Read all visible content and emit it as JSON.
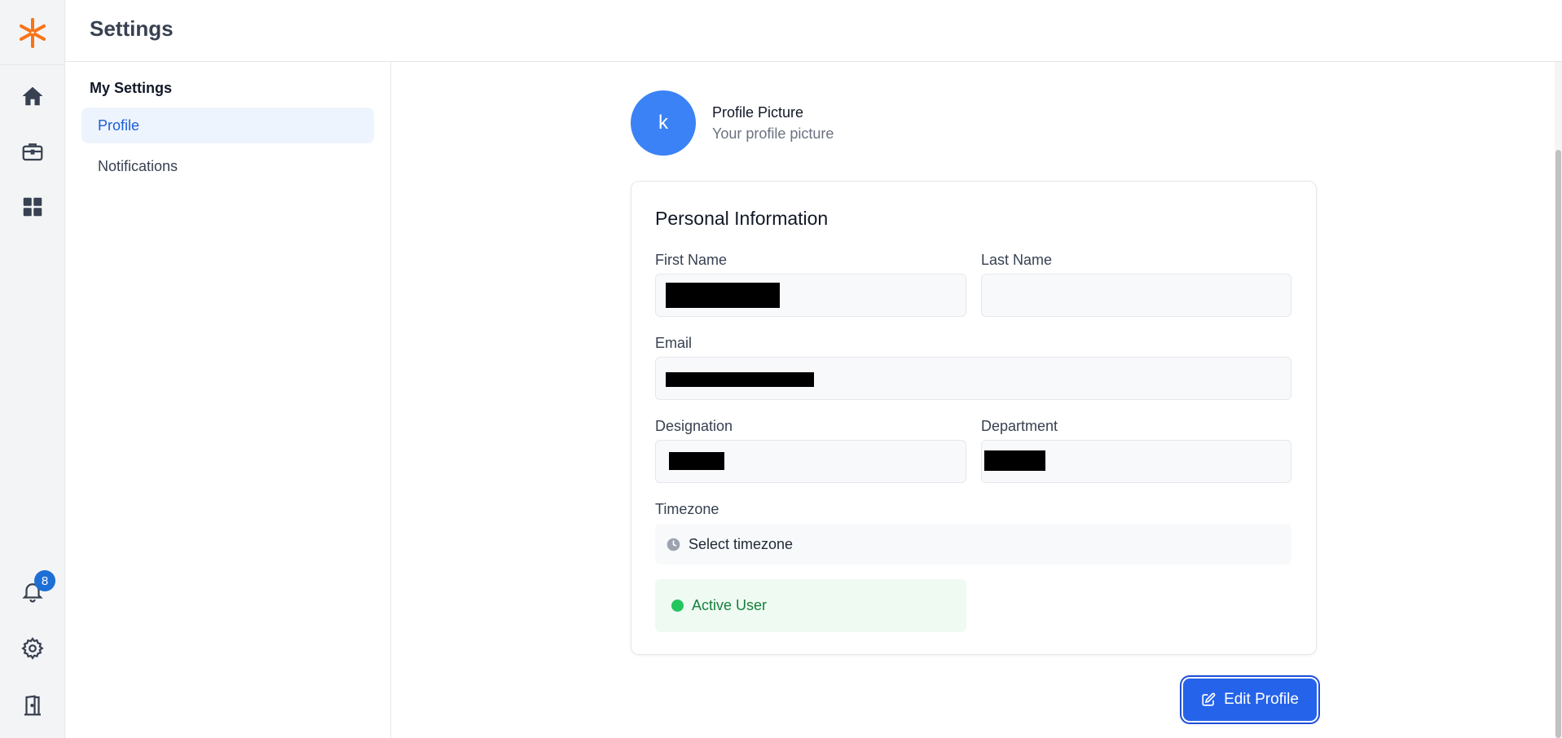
{
  "header": {
    "title": "Settings"
  },
  "rail": {
    "logo_icon": "asterisk-logo-icon",
    "items": [
      {
        "icon": "home-icon"
      },
      {
        "icon": "briefcase-icon"
      },
      {
        "icon": "grid-icon"
      }
    ],
    "bottom_items": [
      {
        "icon": "bell-icon",
        "badge": "8"
      },
      {
        "icon": "gear-icon"
      },
      {
        "icon": "logout-door-icon"
      }
    ],
    "accent": "#f97316"
  },
  "settings_nav": {
    "heading": "My Settings",
    "items": [
      {
        "label": "Profile",
        "active": true
      },
      {
        "label": "Notifications",
        "active": false
      }
    ]
  },
  "profile_picture": {
    "initial": "k",
    "title": "Profile Picture",
    "subtitle": "Your profile picture",
    "color": "#3b82f6"
  },
  "personal_info": {
    "title": "Personal Information",
    "first_name_label": "First Name",
    "last_name_label": "Last Name",
    "email_label": "Email",
    "designation_label": "Designation",
    "department_label": "Department",
    "timezone_label": "Timezone",
    "timezone_placeholder": "Select timezone",
    "status_text": "Active User",
    "status_color": "#22c55e"
  },
  "actions": {
    "edit_profile": "Edit Profile",
    "button_color": "#2563eb"
  }
}
